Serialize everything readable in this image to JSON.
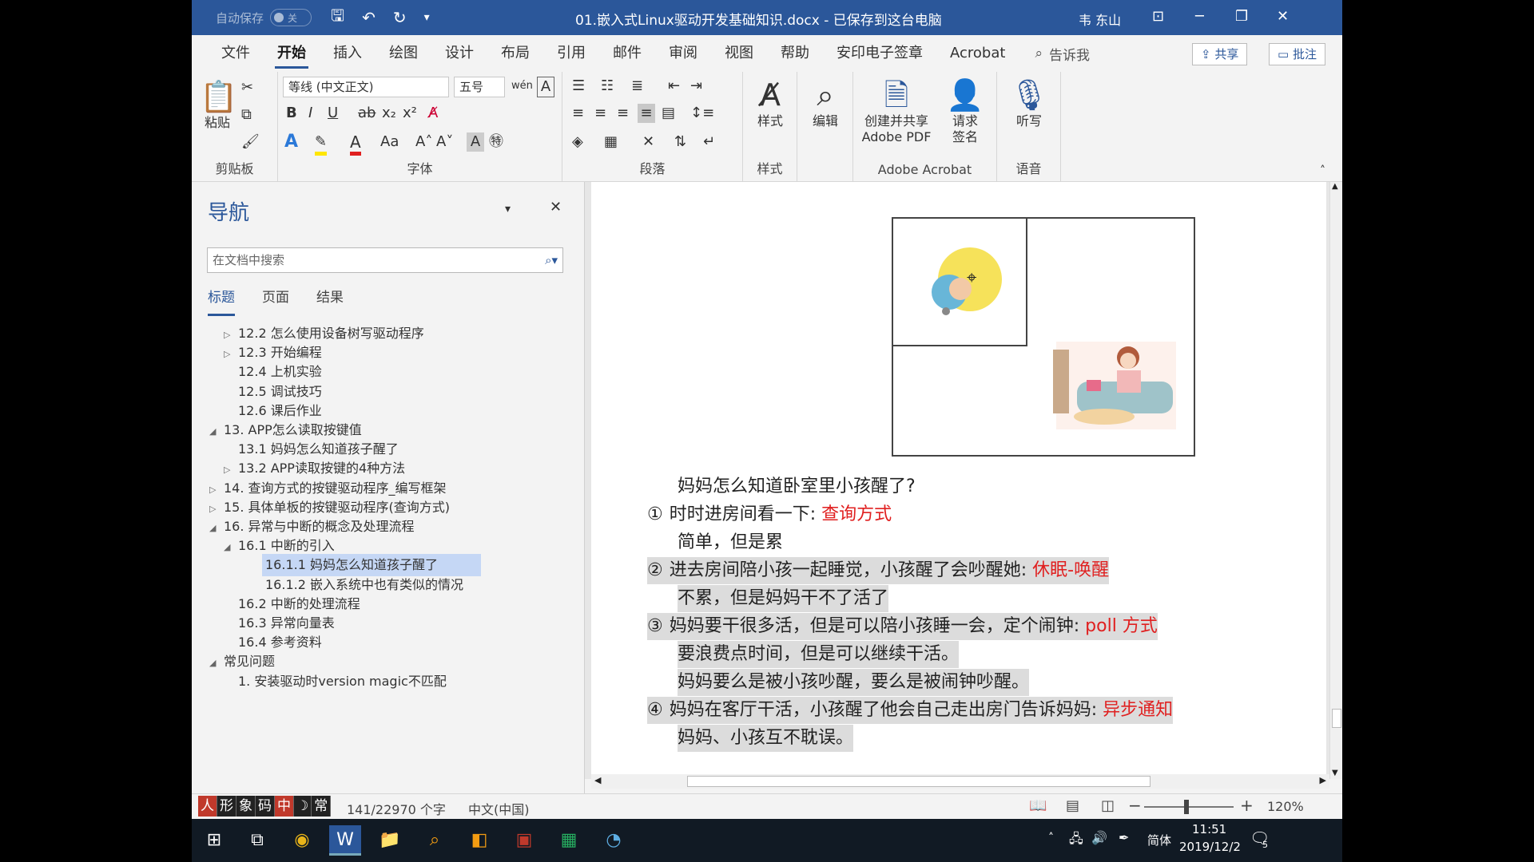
{
  "titlebar": {
    "autosave_label": "自动保存",
    "autosave_state": "关",
    "doc_title": "01.嵌入式Linux驱动开发基础知识.docx - 已保存到这台电脑",
    "user": "韦 东山"
  },
  "tabs": [
    "文件",
    "开始",
    "插入",
    "绘图",
    "设计",
    "布局",
    "引用",
    "邮件",
    "审阅",
    "视图",
    "帮助",
    "安印电子签章",
    "Acrobat"
  ],
  "active_tab": "开始",
  "tellme": "告诉我",
  "share_label": "共享",
  "comment_label": "批注",
  "ribbon": {
    "clipboard": {
      "paste": "粘贴",
      "label": "剪贴板"
    },
    "font": {
      "name": "等线 (中文正文)",
      "size": "五号",
      "label": "字体"
    },
    "paragraph": {
      "label": "段落"
    },
    "styles": {
      "btn": "样式",
      "label": "样式"
    },
    "edit": {
      "btn": "编辑"
    },
    "acrobat": {
      "create": "创建并共享\nAdobe PDF",
      "sign": "请求\n签名",
      "label": "Adobe Acrobat"
    },
    "voice": {
      "btn": "听写",
      "label": "语音"
    }
  },
  "nav": {
    "title": "导航",
    "search_placeholder": "在文档中搜索",
    "tabs": [
      "标题",
      "页面",
      "结果"
    ],
    "headings": [
      {
        "text": "12.2  怎么使用设备树写驱动程序",
        "level": 2,
        "tri": "▷"
      },
      {
        "text": "12.3  开始编程",
        "level": 2,
        "tri": "▷"
      },
      {
        "text": "12.4  上机实验",
        "level": 2,
        "tri": ""
      },
      {
        "text": "12.5  调试技巧",
        "level": 2,
        "tri": ""
      },
      {
        "text": "12.6  课后作业",
        "level": 2,
        "tri": ""
      },
      {
        "text": "13. APP怎么读取按键值",
        "level": 1,
        "tri": "◢"
      },
      {
        "text": "13.1  妈妈怎么知道孩子醒了",
        "level": 2,
        "tri": ""
      },
      {
        "text": "13.2  APP读取按键的4种方法",
        "level": 2,
        "tri": "▷"
      },
      {
        "text": "14. 查询方式的按键驱动程序_编写框架",
        "level": 1,
        "tri": "▷"
      },
      {
        "text": "15. 具体单板的按键驱动程序(查询方式)",
        "level": 1,
        "tri": "▷"
      },
      {
        "text": "16. 异常与中断的概念及处理流程",
        "level": 1,
        "tri": "◢"
      },
      {
        "text": "16.1  中断的引入",
        "level": 2,
        "tri": "◢"
      },
      {
        "text": "16.1.1 妈妈怎么知道孩子醒了",
        "level": 3,
        "tri": "",
        "selected": true
      },
      {
        "text": "16.1.2 嵌入系统中也有类似的情况",
        "level": 3,
        "tri": ""
      },
      {
        "text": "16.2  中断的处理流程",
        "level": 2,
        "tri": ""
      },
      {
        "text": "16.3  异常向量表",
        "level": 2,
        "tri": ""
      },
      {
        "text": "16.4  参考资料",
        "level": 2,
        "tri": ""
      },
      {
        "text": "常见问题",
        "level": 1,
        "tri": "◢"
      },
      {
        "text": "1.  安装驱动时version magic不匹配",
        "level": 2,
        "tri": ""
      }
    ]
  },
  "document": {
    "q": "妈妈怎么知道卧室里小孩醒了?",
    "items": [
      {
        "num": "①",
        "text": "时时进房间看一下: ",
        "tag": "查询方式",
        "sub": [
          "简单，但是累"
        ],
        "hl": false
      },
      {
        "num": "②",
        "text": "进去房间陪小孩一起睡觉，小孩醒了会吵醒她: ",
        "tag": "休眠-唤醒",
        "sub": [
          "不累，但是妈妈干不了活了"
        ],
        "hl": true
      },
      {
        "num": "③",
        "text": "妈妈要干很多活，但是可以陪小孩睡一会，定个闹钟: ",
        "tag": "poll 方式",
        "sub": [
          "要浪费点时间，但是可以继续干活。",
          "妈妈要么是被小孩吵醒，要么是被闹钟吵醒。"
        ],
        "hl": true
      },
      {
        "num": "④",
        "text": "妈妈在客厅干活，小孩醒了他会自己走出房门告诉妈妈: ",
        "tag": "异步通知",
        "sub": [
          "妈妈、小孩互不耽误。"
        ],
        "hl": true
      }
    ]
  },
  "status": {
    "ime": [
      "形",
      "象",
      "码",
      "中",
      "☽",
      "常"
    ],
    "word_count": "141/22970 个字",
    "language": "中文(中国)",
    "zoom": "120%"
  },
  "taskbar": {
    "time": "11:51",
    "date": "2019/12/2",
    "ime_lang": "简体",
    "notif_count": "5"
  },
  "colors": {
    "accent": "#2b579a",
    "highlight_red": "#e02020",
    "selected_nav": "#c5d7f5"
  }
}
